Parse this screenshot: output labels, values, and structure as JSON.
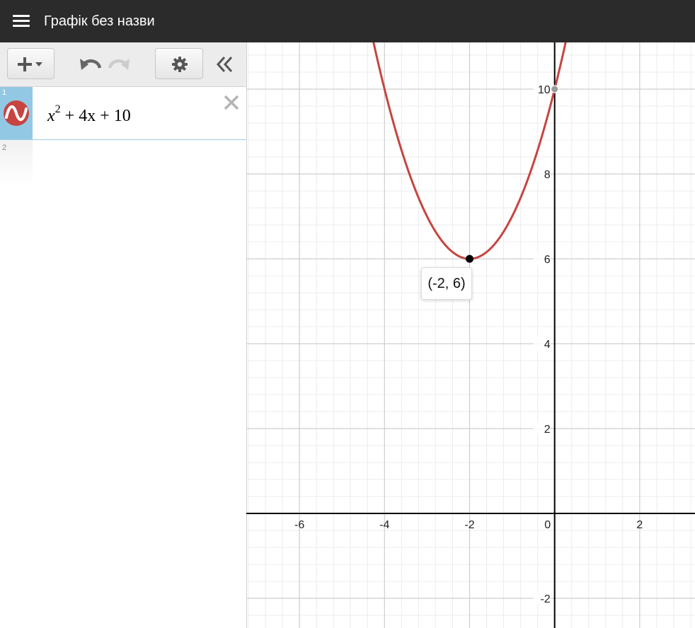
{
  "header": {
    "title": "Графік без назви",
    "menu_icon": "hamburger-menu-icon"
  },
  "toolbar": {
    "add_icon": "plus-dropdown-icon",
    "undo_icon": "undo-icon",
    "redo_icon": "redo-icon",
    "settings_icon": "gear-icon",
    "collapse_icon": "double-chevron-left-icon"
  },
  "expressions": [
    {
      "number": "1",
      "base": "x",
      "exponent": "2",
      "rest": " + 4x + 10",
      "color": "#c74440",
      "icon": "graph-wave-icon"
    },
    {
      "number": "2"
    }
  ],
  "graph": {
    "x_ticks": [
      "-6",
      "-4",
      "-2",
      "0",
      "2"
    ],
    "y_ticks": [
      "10",
      "8",
      "6",
      "4",
      "2",
      "-2"
    ],
    "point_label": "(-2, 6)",
    "colors": {
      "curve": "#c74440",
      "axis": "#000000",
      "major_grid": "#cdcdcd",
      "minor_grid": "#ececec"
    }
  },
  "chart_data": {
    "type": "line",
    "series": [
      {
        "name": "x^2 + 4x + 10",
        "function": "x^2 + 4x + 10"
      }
    ],
    "points": [
      {
        "x": -2,
        "y": 6,
        "label": "(-2, 6)"
      },
      {
        "x": 0,
        "y": 10
      }
    ],
    "xlim": [
      -7.25,
      3.3
    ],
    "ylim": [
      -2.7,
      11.1
    ],
    "xticks": [
      -6,
      -4,
      -2,
      0,
      2
    ],
    "yticks": [
      -2,
      2,
      4,
      6,
      8,
      10
    ],
    "grid": true
  }
}
